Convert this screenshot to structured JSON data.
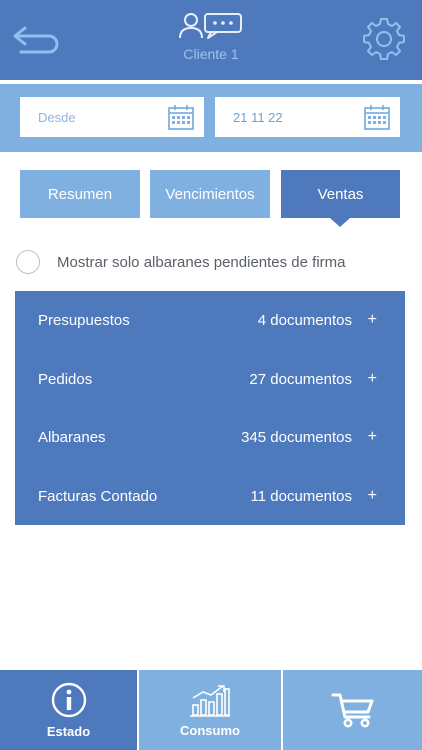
{
  "header": {
    "client_name": "Cliente 1",
    "back_icon": "back-arrow-icon",
    "client_icon": "client-chat-icon",
    "settings_icon": "gear-icon"
  },
  "dates": {
    "from_placeholder": "Desde",
    "to_value": "21 11 22",
    "calendar_icon": "calendar-icon"
  },
  "tabs": [
    {
      "label": "Resumen",
      "active": false
    },
    {
      "label": "Vencimientos",
      "active": false
    },
    {
      "label": "Ventas",
      "active": true
    }
  ],
  "filter": {
    "label": "Mostrar solo albaranes pendientes de firma",
    "checked": false
  },
  "documents": [
    {
      "label": "Presupuestos",
      "count": "4 documentos",
      "action": "+"
    },
    {
      "label": "Pedidos",
      "count": "27 documentos",
      "action": "+"
    },
    {
      "label": "Albaranes",
      "count": "345 documentos",
      "action": "+"
    },
    {
      "label": "Facturas Contado",
      "count": "11 documentos",
      "action": "+"
    }
  ],
  "bottom_nav": [
    {
      "label": "Estado",
      "icon": "info-icon",
      "active": true
    },
    {
      "label": "Consumo",
      "icon": "chart-icon",
      "active": false
    },
    {
      "label": "",
      "icon": "cart-icon",
      "active": false
    }
  ],
  "colors": {
    "primary": "#4f79bd",
    "secondary": "#7fb0df",
    "text_muted": "#5a6069"
  }
}
